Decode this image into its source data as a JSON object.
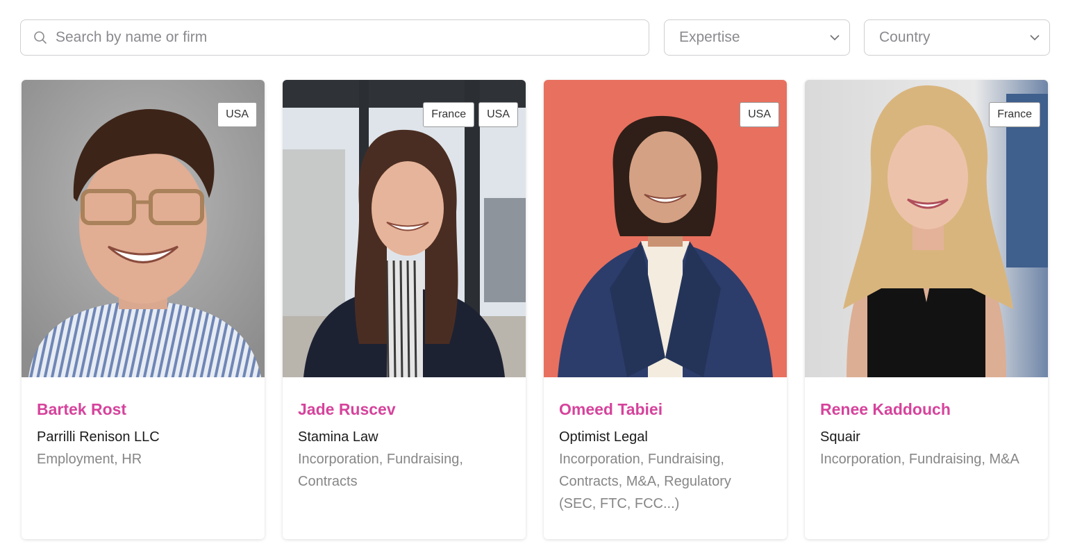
{
  "search": {
    "placeholder": "Search by name or firm"
  },
  "filters": {
    "expertise_label": "Expertise",
    "country_label": "Country"
  },
  "colors": {
    "name_accent": "#d6439c",
    "card_bg": "#ffffff",
    "omeed_bg": "#e8705f"
  },
  "lawyers": [
    {
      "name": "Bartek Rost",
      "firm": "Parrilli Renison LLC",
      "expertise": "Employment, HR",
      "countries": [
        "USA"
      ]
    },
    {
      "name": "Jade Ruscev",
      "firm": "Stamina Law",
      "expertise": "Incorporation, Fundraising, Contracts",
      "countries": [
        "France",
        "USA"
      ]
    },
    {
      "name": "Omeed Tabiei",
      "firm": "Optimist Legal",
      "expertise": "Incorporation, Fundraising, Contracts, M&A, Regulatory (SEC, FTC, FCC...)",
      "countries": [
        "USA"
      ]
    },
    {
      "name": "Renee Kaddouch",
      "firm": "Squair",
      "expertise": "Incorporation, Fundraising, M&A",
      "countries": [
        "France"
      ]
    }
  ]
}
